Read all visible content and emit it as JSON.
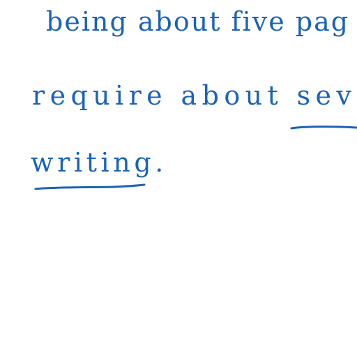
{
  "document": {
    "lines": [
      "being about five pag",
      "require about sev",
      "writing."
    ],
    "ink_color": "#1a63b8"
  }
}
